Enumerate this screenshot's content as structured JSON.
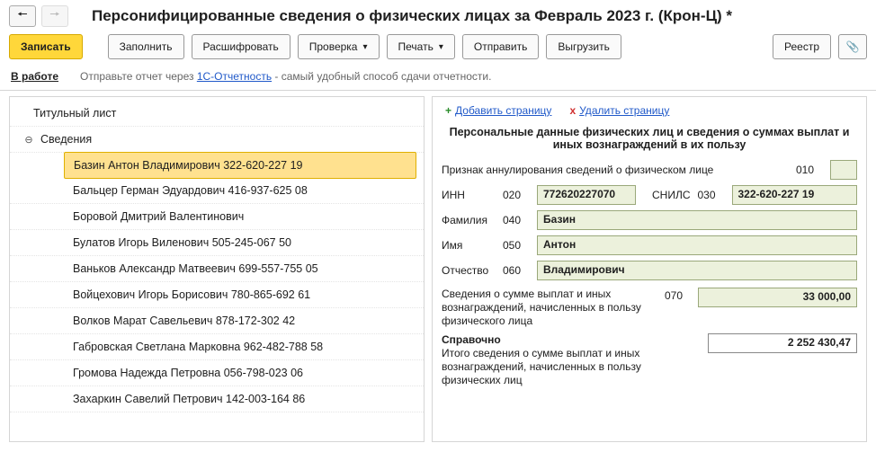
{
  "header": {
    "title": "Персонифицированные сведения о физических лицах за Февраль 2023 г. (Крон-Ц) *"
  },
  "toolbar": {
    "save": "Записать",
    "fill": "Заполнить",
    "decrypt": "Расшифровать",
    "check": "Проверка",
    "print": "Печать",
    "send": "Отправить",
    "export": "Выгрузить",
    "registry": "Реестр"
  },
  "status": {
    "state": "В работе",
    "hint_before": "Отправьте отчет через ",
    "hint_link": "1С-Отчетность",
    "hint_after": " - самый удобный способ сдачи отчетности."
  },
  "tree": {
    "title_page": "Титульный лист",
    "group": "Сведения",
    "items": [
      "Базин Антон Владимирович 322-620-227 19",
      "Бальцер Герман Эдуардович 416-937-625 08",
      "Боровой Дмитрий Валентинович",
      "Булатов Игорь Виленович 505-245-067 50",
      "Ваньков Александр Матвеевич 699-557-755 05",
      "Войцехович Игорь Борисович 780-865-692 61",
      "Волков Марат Савельевич 878-172-302 42",
      "Габровская Светлана Марковна 962-482-788 58",
      "Громова Надежда Петровна 056-798-023 06",
      "Захаркин Савелий Петрович 142-003-164 86"
    ]
  },
  "page_actions": {
    "add": "Добавить страницу",
    "delete": "Удалить страницу"
  },
  "form": {
    "section_title": "Персональные данные физических лиц и сведения о суммах выплат и иных вознаграждений в их пользу",
    "annul_label": "Признак аннулирования сведений о физическом лице",
    "annul_code": "010",
    "annul_value": "",
    "inn_label": "ИНН",
    "inn_code": "020",
    "inn_value": "772620227070",
    "snils_label": "СНИЛС",
    "snils_code": "030",
    "snils_value": "322-620-227 19",
    "fam_label": "Фамилия",
    "fam_code": "040",
    "fam_value": "Базин",
    "name_label": "Имя",
    "name_code": "050",
    "name_value": "Антон",
    "pat_label": "Отчество",
    "pat_code": "060",
    "pat_value": "Владимирович",
    "sum_note": "Сведения о сумме выплат и иных вознаграждений, начисленных в пользу физического лица",
    "sum_code": "070",
    "sum_value": "33 000,00",
    "ref_header": "Справочно",
    "ref_note": "Итого сведения о сумме выплат и иных вознаграждений, начисленных в пользу физических лиц",
    "ref_value": "2 252 430,47"
  }
}
